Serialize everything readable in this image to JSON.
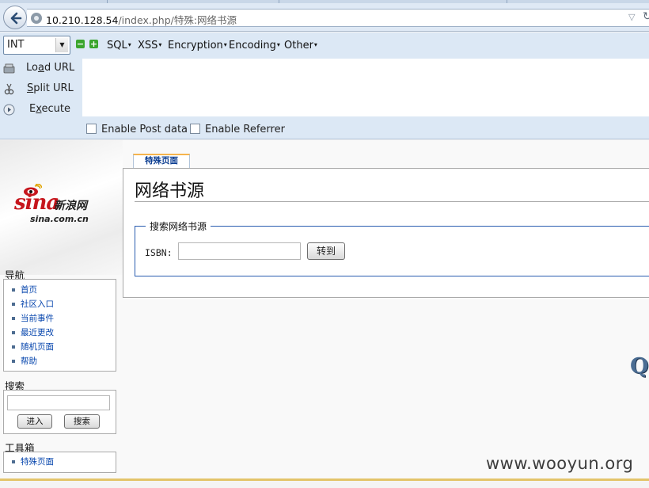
{
  "browser": {
    "url_host": "10.210.128.54",
    "url_path": "/index.php/特殊:网络书源"
  },
  "hackbar": {
    "type_select": "INT",
    "menus": [
      "SQL",
      "XSS",
      "Encryption",
      "Encoding",
      "Other"
    ],
    "actions": {
      "load_pre": "Lo",
      "load_key": "a",
      "load_post": "d URL",
      "split_pre": "",
      "split_key": "S",
      "split_post": "plit URL",
      "exec_pre": "E",
      "exec_key": "x",
      "exec_post": "ecute"
    },
    "url_value": "",
    "enable_post": "Enable Post data",
    "enable_referrer": "Enable Referrer"
  },
  "sidebar": {
    "logo_main": "sina",
    "logo_cn": "新浪网",
    "logo_domain": "sina.com.cn",
    "nav_title": "导航",
    "nav_items": [
      "首页",
      "社区入口",
      "当前事件",
      "最近更改",
      "随机页面",
      "帮助"
    ],
    "search_title": "搜索",
    "search_go": "进入",
    "search_search": "搜索",
    "toolbox_title": "工具箱",
    "toolbox_items": [
      "特殊页面"
    ]
  },
  "content": {
    "tab_label": "特殊页面",
    "heading": "网络书源",
    "legend": "搜索网络书源",
    "isbn_label": "ISBN:",
    "goto_label": "转到"
  },
  "decor": {
    "qc_text": "Q(",
    "watermark": "www.wooyun.org"
  }
}
